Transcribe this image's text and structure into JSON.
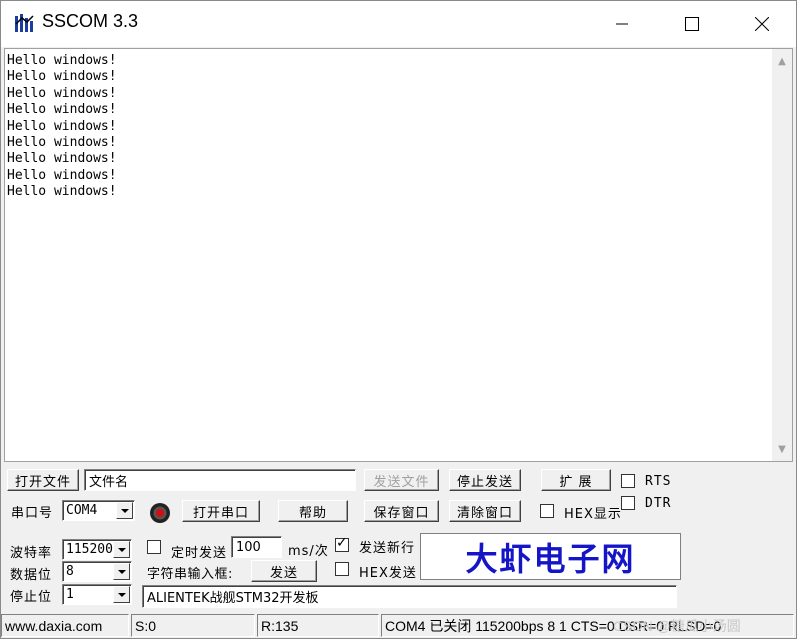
{
  "window": {
    "title": "SSCOM 3.3"
  },
  "receive": {
    "lines": [
      "Hello windows!",
      "Hello windows!",
      "Hello windows!",
      "Hello windows!",
      "Hello windows!",
      "Hello windows!",
      "Hello windows!",
      "Hello windows!",
      "Hello windows!"
    ]
  },
  "row1": {
    "open_file": "打开文件",
    "file_name": "文件名",
    "send_file": "发送文件",
    "stop_send": "停止发送",
    "expand": "扩 展",
    "rts": "RTS"
  },
  "row2": {
    "port_label": "串口号",
    "port_value": "COM4",
    "open_port": "打开串口",
    "help": "帮助",
    "save_window": "保存窗口",
    "clear_window": "清除窗口",
    "hex_display": "HEX显示",
    "dtr": "DTR"
  },
  "settings": {
    "baud_label": "波特率",
    "baud_value": "115200",
    "databits_label": "数据位",
    "databits_value": "8",
    "stopbits_label": "停止位",
    "stopbits_value": "1",
    "timed_send": "定时发送",
    "interval_value": "100",
    "interval_unit": "ms/次",
    "send_newline": "发送新行",
    "send_newline_checked": true,
    "string_input_label": "字符串输入框:",
    "send": "发送",
    "hex_send": "HEX发送",
    "input_value": "ALIENTEK战舰STM32开发板"
  },
  "brand": "大虾电子网",
  "status": {
    "website": "www.daxia.com",
    "sent": "S:0",
    "received": "R:135",
    "port_status": "COM4 已关闭  115200bps  8 1 CTS=0 DSR=0 RLSD=0",
    "watermark": "CSDN @糖瓜小汤圆"
  }
}
